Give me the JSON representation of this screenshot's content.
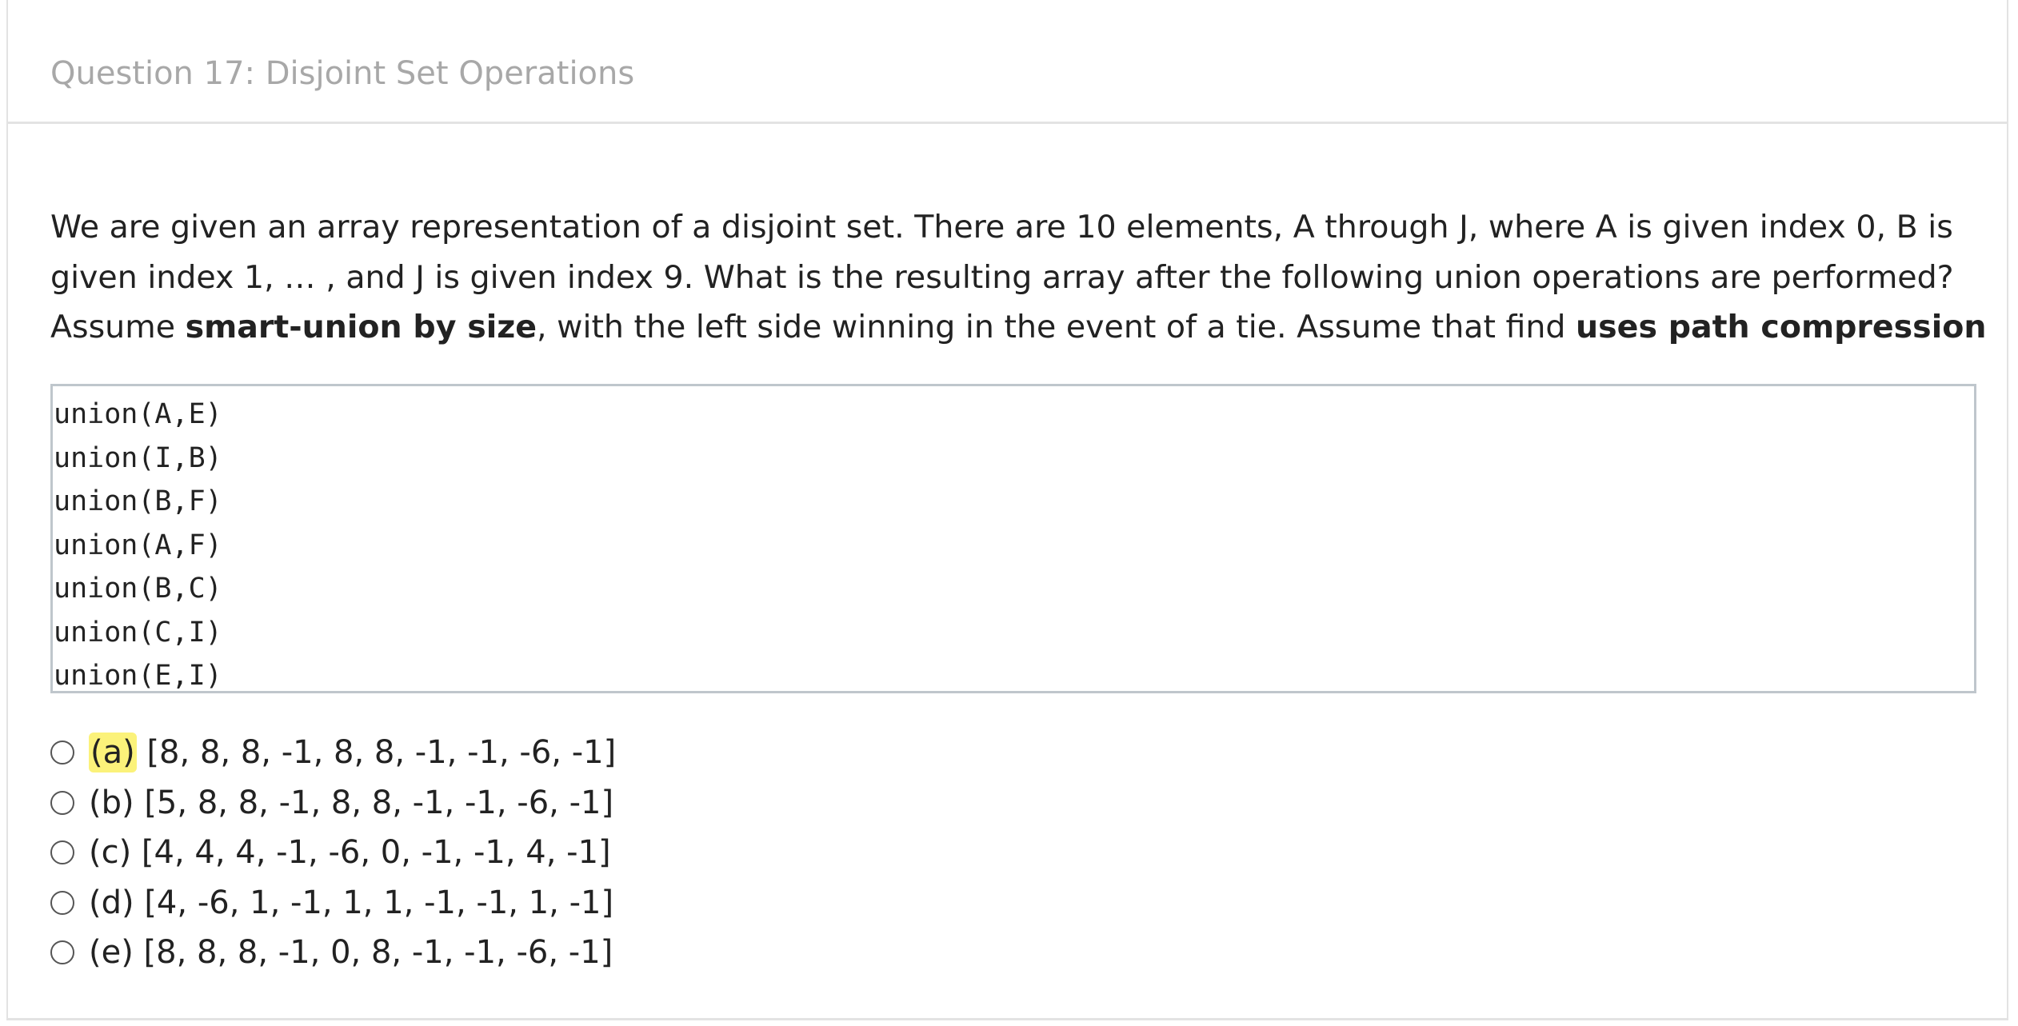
{
  "question": {
    "title": "Question 17: Disjoint Set Operations",
    "prompt": {
      "p1": "We are given an array representation of a disjoint set. There are 10 elements, A through J, where A is given index 0, B is given index 1, … , and J is given index 9. What is the resulting array after the following union operations are performed? Assume ",
      "b1": "smart-union by size",
      "p2": ", with the left side winning in the event of a tie. Assume that find ",
      "b2": "uses path compression"
    },
    "code_lines": [
      "union(A,E)",
      "union(I,B)",
      "union(B,F)",
      "union(A,F)",
      "union(B,C)",
      "union(C,I)",
      "union(E,I)"
    ],
    "options": [
      {
        "letter": "(a)",
        "array": "[8, 8, 8, -1, 8, 8, -1, -1, -6, -1]"
      },
      {
        "letter": "(b)",
        "array": "[5, 8, 8, -1, 8, 8, -1, -1, -6, -1]"
      },
      {
        "letter": "(c)",
        "array": "[4, 4, 4, -1, -6, 0, -1, -1, 4, -1]"
      },
      {
        "letter": "(d)",
        "array": "[4, -6, 1, -1, 1, 1, -1, -1, 1, -1]"
      },
      {
        "letter": "(e)",
        "array": "[8, 8, 8, -1, 0, 8, -1, -1, -6, -1]"
      }
    ],
    "highlight_color": "#fbf27a"
  }
}
